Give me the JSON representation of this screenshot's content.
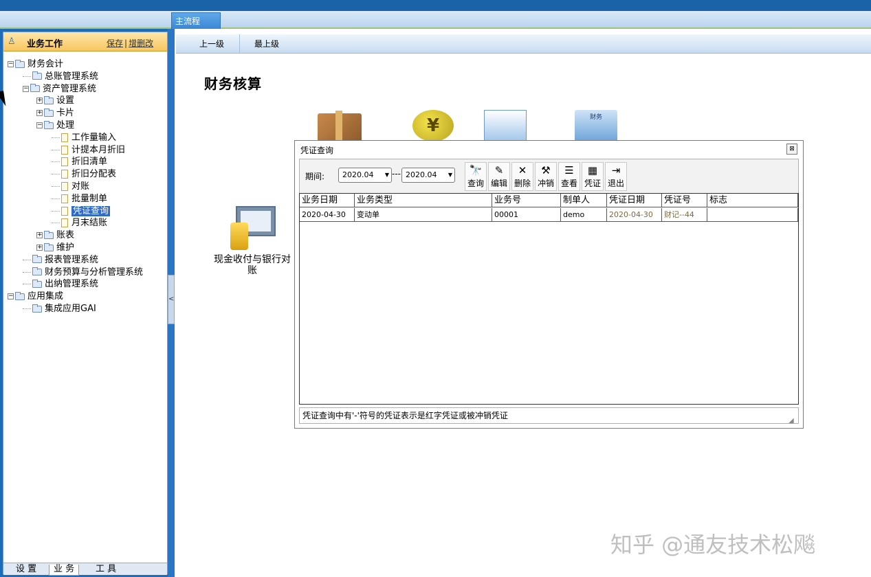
{
  "tabstrip": {
    "active_tab": "主流程"
  },
  "left_panel": {
    "title": "业务工作",
    "links": [
      "保存",
      "增删改"
    ],
    "tree": [
      {
        "label": "财务会计",
        "level": 0,
        "type": "folder",
        "expand": "−"
      },
      {
        "label": "总账管理系统",
        "level": 1,
        "type": "folder",
        "expand": ""
      },
      {
        "label": "资产管理系统",
        "level": 1,
        "type": "folder",
        "expand": "−"
      },
      {
        "label": "设置",
        "level": 2,
        "type": "folder",
        "expand": "+"
      },
      {
        "label": "卡片",
        "level": 2,
        "type": "folder",
        "expand": "+"
      },
      {
        "label": "处理",
        "level": 2,
        "type": "folder",
        "expand": "−"
      },
      {
        "label": "工作量输入",
        "level": 3,
        "type": "doc"
      },
      {
        "label": "计提本月折旧",
        "level": 3,
        "type": "doc"
      },
      {
        "label": "折旧清单",
        "level": 3,
        "type": "doc"
      },
      {
        "label": "折旧分配表",
        "level": 3,
        "type": "doc"
      },
      {
        "label": "对账",
        "level": 3,
        "type": "doc"
      },
      {
        "label": "批量制单",
        "level": 3,
        "type": "doc"
      },
      {
        "label": "凭证查询",
        "level": 3,
        "type": "doc",
        "selected": true
      },
      {
        "label": "月末结账",
        "level": 3,
        "type": "doc"
      },
      {
        "label": "账表",
        "level": 2,
        "type": "folder",
        "expand": "+"
      },
      {
        "label": "维护",
        "level": 2,
        "type": "folder",
        "expand": "+"
      },
      {
        "label": "报表管理系统",
        "level": 1,
        "type": "folder",
        "expand": ""
      },
      {
        "label": "财务预算与分析管理系统",
        "level": 1,
        "type": "folder",
        "expand": ""
      },
      {
        "label": "出纳管理系统",
        "level": 1,
        "type": "folder",
        "expand": ""
      },
      {
        "label": "应用集成",
        "level": 0,
        "type": "folder",
        "expand": "−"
      },
      {
        "label": "集成应用GAI",
        "level": 1,
        "type": "folder",
        "expand": ""
      }
    ],
    "bottom_tabs": [
      "设 置",
      "业 务",
      "工 具"
    ],
    "active_bottom_tab": 1,
    "collapse_glyph": "<"
  },
  "nav": {
    "up_one": "上一级",
    "top_level": "最上级"
  },
  "main": {
    "page_title": "财务核算",
    "cash_module_label": "现金收付与银行对账",
    "finance_icon_text": "财务"
  },
  "dialog": {
    "title": "凭证查询",
    "close_glyph": "⊠",
    "period_label": "期间:",
    "period_from": "2020.04",
    "period_separator": "---",
    "period_to": "2020.04",
    "buttons": [
      {
        "label": "查询",
        "icon": "binoculars-icon",
        "glyph": "🔭"
      },
      {
        "label": "编辑",
        "icon": "edit-icon",
        "glyph": "✎"
      },
      {
        "label": "删除",
        "icon": "delete-icon",
        "glyph": "✕"
      },
      {
        "label": "冲销",
        "icon": "hammer-icon",
        "glyph": "⚒"
      },
      {
        "label": "查看",
        "icon": "view-icon",
        "glyph": "☰"
      },
      {
        "label": "凭证",
        "icon": "voucher-icon",
        "glyph": "▦"
      },
      {
        "label": "退出",
        "icon": "exit-icon",
        "glyph": "⇥"
      }
    ],
    "columns": [
      "业务日期",
      "业务类型",
      "业务号",
      "制单人",
      "凭证日期",
      "凭证号",
      "标志"
    ],
    "rows": [
      [
        "2020-04-30",
        "变动单",
        "00001",
        "demo",
        "2020-04-30",
        "财记--44",
        ""
      ]
    ],
    "status_text": "凭证查询中有'-'符号的凭证表示是红字凭证或被冲销凭证"
  },
  "watermark": "知乎 @通友技术松飚",
  "colors": {
    "accent": "#1b63a8",
    "selected": "#316ac5"
  }
}
